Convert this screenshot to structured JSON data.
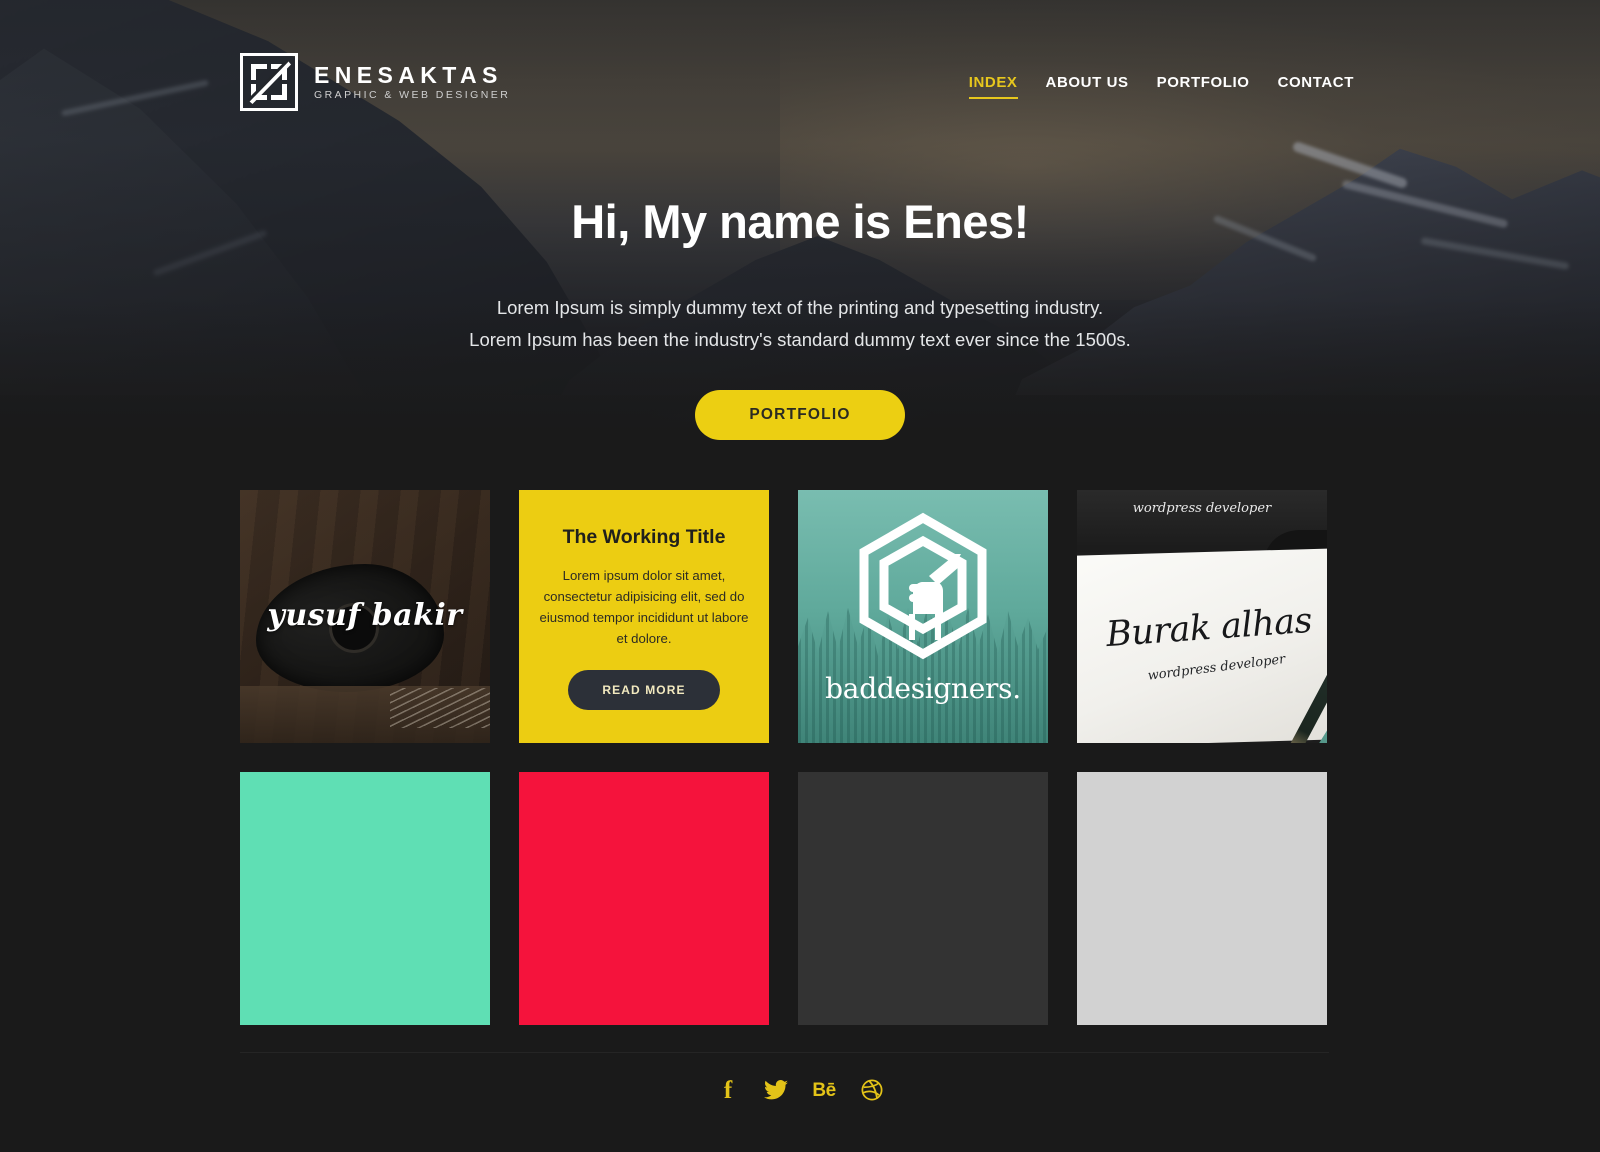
{
  "brand": {
    "name": "ENESAKTAS",
    "tagline": "GRAPHIC & WEB DESIGNER",
    "logo_icon": "monogram-square-icon"
  },
  "nav": {
    "items": [
      {
        "label": "INDEX",
        "active": true
      },
      {
        "label": "ABOUT US",
        "active": false
      },
      {
        "label": "PORTFOLIO",
        "active": false
      },
      {
        "label": "CONTACT",
        "active": false
      }
    ],
    "active_color": "#e7c71d"
  },
  "hero": {
    "title": "Hi, My name is Enes!",
    "subtitle_line1": "Lorem Ipsum is simply dummy text of the printing and typesetting industry.",
    "subtitle_line2": "Lorem Ipsum has been the industry's standard dummy text ever since the 1500s.",
    "cta_label": "PORTFOLIO",
    "cta_bg": "#eccf12",
    "cta_text_color": "#2b2b22"
  },
  "portfolio": {
    "row1": [
      {
        "kind": "image",
        "name": "yusuf-bakir",
        "logo_text": "yusuf bakir",
        "bg": "#2a2019"
      },
      {
        "kind": "text-card",
        "name": "the-working-title",
        "title": "The Working Title",
        "body": "Lorem ipsum dolor sit amet, consectetur adipisicing elit, sed do eiusmod tempor incididunt ut labore et dolore.",
        "button_label": "READ MORE",
        "bg": "#eccd12",
        "button_bg": "#2c3038"
      },
      {
        "kind": "image",
        "name": "baddesigners",
        "logo_text": "baddesigners.",
        "bg": "#5fa99b",
        "icon": "hexagon-fist-pencil-icon"
      },
      {
        "kind": "image",
        "name": "burak-alhas",
        "top_text": "wordpress developer",
        "logo_text": "Burak alhas",
        "sub_text": "wordpress developer",
        "bg": "#f1f0ec"
      }
    ],
    "row2": [
      {
        "kind": "solid",
        "name": "tile-mint",
        "color": "#5fdfb4"
      },
      {
        "kind": "solid",
        "name": "tile-crimson",
        "color": "#f5133c"
      },
      {
        "kind": "solid",
        "name": "tile-dark-gray",
        "color": "#333333"
      },
      {
        "kind": "solid",
        "name": "tile-light-gray",
        "color": "#d2d2d2"
      }
    ]
  },
  "footer": {
    "social": [
      {
        "name": "facebook-icon",
        "glyph": "f"
      },
      {
        "name": "twitter-icon",
        "glyph": ""
      },
      {
        "name": "behance-icon",
        "glyph": "Bē"
      },
      {
        "name": "dribbble-icon",
        "glyph": ""
      }
    ],
    "icon_color": "#e3c318"
  }
}
